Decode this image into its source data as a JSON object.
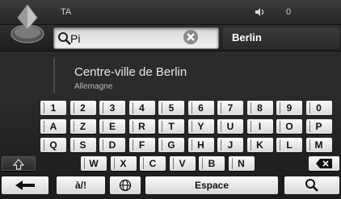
{
  "status": {
    "title": "TA",
    "volume_icon": "volume-icon",
    "volume_level": "0"
  },
  "search": {
    "query": "Pi",
    "clear_icon": "close-icon",
    "city": "Berlin"
  },
  "result": {
    "title": "Centre-ville de Berlin",
    "country": "Allemagne"
  },
  "keyboard": {
    "row1": [
      "1",
      "2",
      "3",
      "4",
      "5",
      "6",
      "7",
      "8",
      "9",
      "0"
    ],
    "row2": [
      "A",
      "Z",
      "E",
      "R",
      "T",
      "Y",
      "U",
      "I",
      "O",
      "P"
    ],
    "row3": [
      "Q",
      "S",
      "D",
      "F",
      "G",
      "H",
      "J",
      "K",
      "L",
      "M"
    ],
    "row4": [
      "W",
      "X",
      "C",
      "V",
      "B",
      "N"
    ],
    "shift_icon": "shift-icon",
    "backspace_icon": "backspace-icon",
    "bottom": {
      "back_icon": "back-arrow-icon",
      "symbols": "à/!",
      "globe_icon": "globe-icon",
      "space": "Espace",
      "search_icon": "search-icon"
    }
  },
  "colors": {
    "background": "#1b1b1b",
    "key": "#f0f0f0",
    "accent": "#c0c0c0"
  }
}
